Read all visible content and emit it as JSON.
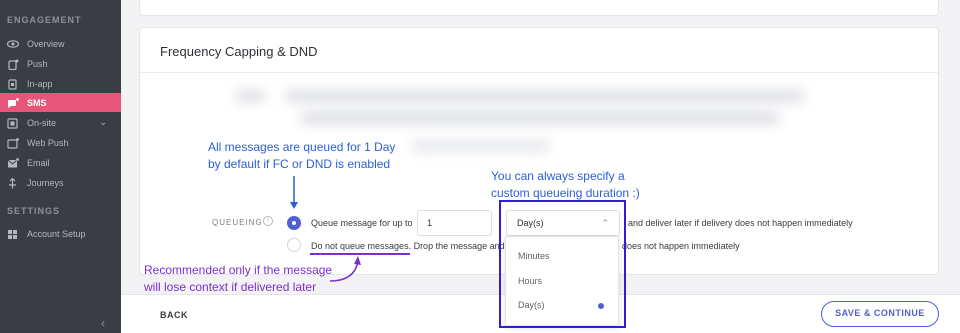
{
  "sidebar": {
    "engagement_header": "ENGAGEMENT",
    "settings_header": "SETTINGS",
    "items": [
      {
        "label": "Overview",
        "icon": "eye-icon"
      },
      {
        "label": "Push",
        "icon": "push-icon"
      },
      {
        "label": "In-app",
        "icon": "in-app-icon"
      },
      {
        "label": "SMS",
        "icon": "sms-icon",
        "active": true
      },
      {
        "label": "On-site",
        "icon": "on-site-icon",
        "chevron": "⌄"
      },
      {
        "label": "Web Push",
        "icon": "web-push-icon"
      },
      {
        "label": "Email",
        "icon": "email-icon"
      },
      {
        "label": "Journeys",
        "icon": "journeys-icon"
      }
    ],
    "settings_items": [
      {
        "label": "Account Setup",
        "icon": "grid-icon"
      }
    ],
    "collapse_glyph": "‹",
    "active_color": "#e8557a"
  },
  "card": {
    "title": "Frequency Capping & DND"
  },
  "queueing": {
    "label": "QUEUEING",
    "info_glyph": "i",
    "option1_prefix": "Queue message for up to",
    "option1_suffix": "and deliver later if delivery does not happen immediately",
    "duration_value": "1",
    "unit_selected": "Day(s)",
    "unit_caret": "⌃",
    "option2_prefix": "Do not queue messages. Drop the message and c",
    "option2_suffix": "does not happen immediately",
    "unit_options": [
      "Minutes",
      "Hours",
      "Day(s)"
    ]
  },
  "footer": {
    "back_label": "BACK",
    "save_label": "SAVE & CONTINUE",
    "accent": "#4f5fd4"
  },
  "annotations": {
    "queued_line1": "All messages are queued for 1 Day",
    "queued_line2": "by default if FC or DND is enabled",
    "custom_line1": "You can always specify a",
    "custom_line2": "custom queueing duration :)",
    "recommended_line1": "Recommended only if the message",
    "recommended_line2": "will lose context if delivered later"
  }
}
